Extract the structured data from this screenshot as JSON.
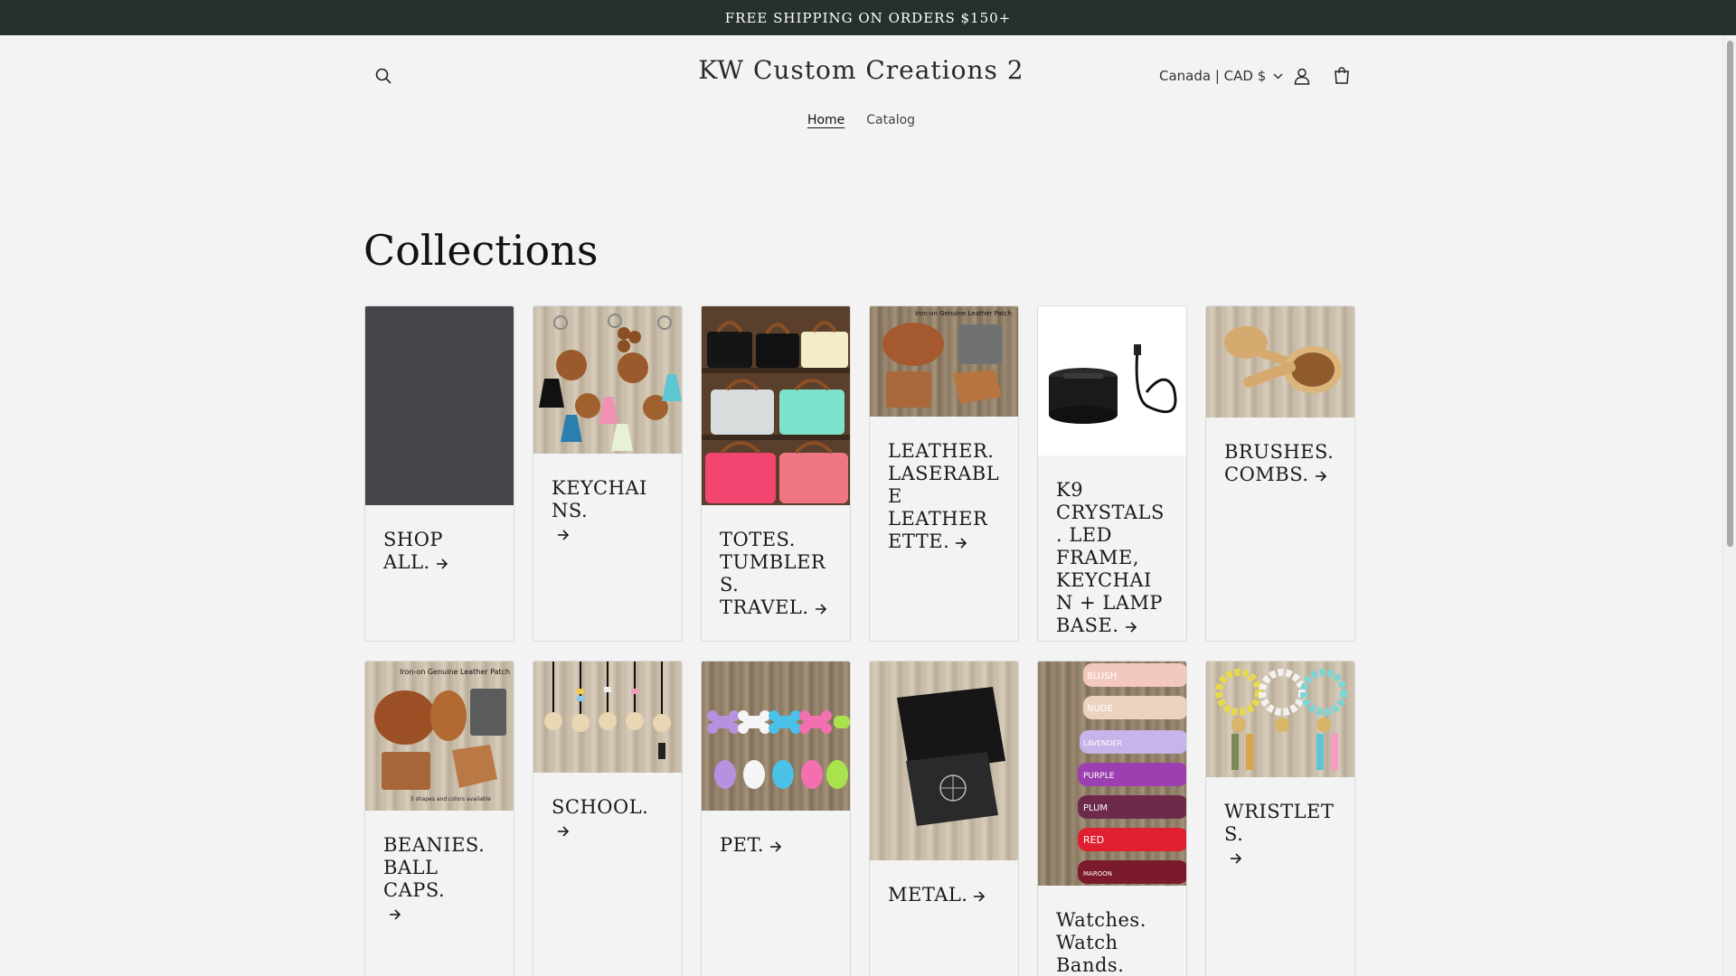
{
  "announcement": "FREE SHIPPING ON ORDERS $150+",
  "store": {
    "name": "KW Custom Creations 2"
  },
  "header": {
    "country": "Canada | CAD $"
  },
  "nav": {
    "items": [
      {
        "label": "Home",
        "active": true
      },
      {
        "label": "Catalog",
        "active": false
      }
    ]
  },
  "page": {
    "title": "Collections"
  },
  "collections": [
    {
      "label": "SHOP ALL.",
      "icon": "solid-dark-placeholder"
    },
    {
      "label": "KEYCHAINS.",
      "icon": "keychain-tassels-image"
    },
    {
      "label": "TOTES. TUMBLERS. TRAVEL.",
      "icon": "tote-bags-image"
    },
    {
      "label": "LEATHER. LASERABLE LEATHERETTE.",
      "icon": "leather-patches-image"
    },
    {
      "label": "K9 CRYSTALS. LED FRAME, KEYCHAIN + LAMP BASE.",
      "icon": "led-lamp-base-image"
    },
    {
      "label": "BRUSHES. COMBS.",
      "icon": "bamboo-brush-image"
    },
    {
      "label": "BEANIES. BALL CAPS.",
      "icon": "leather-patch-image"
    },
    {
      "label": "SCHOOL.",
      "icon": "lanyards-image"
    },
    {
      "label": "PET.",
      "icon": "bone-keychains-image"
    },
    {
      "label": "METAL.",
      "icon": "metal-card-image"
    },
    {
      "label": "Watches. Watch Bands.",
      "icon": "watch-bands-image"
    },
    {
      "label": "WRISTLETS.",
      "icon": "bead-wristlets-image"
    }
  ],
  "images": {
    "leather_patch_text": "Iron-on Genuine Leather Patch",
    "leather_patch_caption": "5 shapes and colors available",
    "watch_band_colors": [
      "BLUSH",
      "NUDE",
      "LAVENDER",
      "PURPLE",
      "PLUM",
      "RED",
      "MAROON"
    ]
  },
  "colors": {
    "announcement_bg": "#26302c",
    "page_bg": "#f3f3f3"
  }
}
